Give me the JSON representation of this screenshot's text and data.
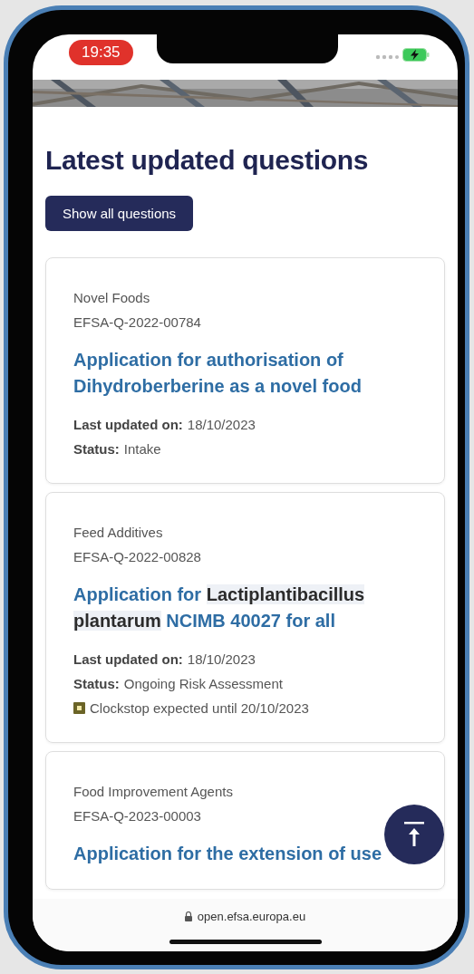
{
  "status_bar": {
    "time": "19:35"
  },
  "page": {
    "heading": "Latest updated questions",
    "button": "Show all questions"
  },
  "questions": [
    {
      "category": "Novel Foods",
      "id": "EFSA-Q-2022-00784",
      "title": [
        [
          {
            "text": "Application for authorisation of",
            "highlighted": false
          }
        ],
        [
          {
            "text": "Dihydroberberine as a novel food",
            "highlighted": false
          }
        ]
      ],
      "meta": [
        {
          "label": "Last updated on:",
          "value": "18/10/2023"
        },
        {
          "label": "Status:",
          "value": "Intake"
        }
      ]
    },
    {
      "category": "Feed Additives",
      "id": "EFSA-Q-2022-00828",
      "title": [
        [
          {
            "text": "Application for",
            "highlighted": false
          },
          {
            "text": "Lactiplantibacillus",
            "highlighted": true
          }
        ],
        [
          {
            "text": "plantarum",
            "highlighted": true
          },
          {
            "text": "NCIMB 40027 for all",
            "highlighted": false
          }
        ]
      ],
      "meta": [
        {
          "label": "Last updated on:",
          "value": "18/10/2023"
        },
        {
          "label": "Status:",
          "value": "Ongoing Risk Assessment"
        }
      ],
      "clockstop": "Clockstop expected until 20/10/2023"
    },
    {
      "category": "Food Improvement Agents",
      "id": "EFSA-Q-2023-00003",
      "title": [
        [
          {
            "text": "Application for the extension of use",
            "highlighted": false
          }
        ]
      ]
    }
  ],
  "address_bar": {
    "url": "open.efsa.europa.eu"
  }
}
